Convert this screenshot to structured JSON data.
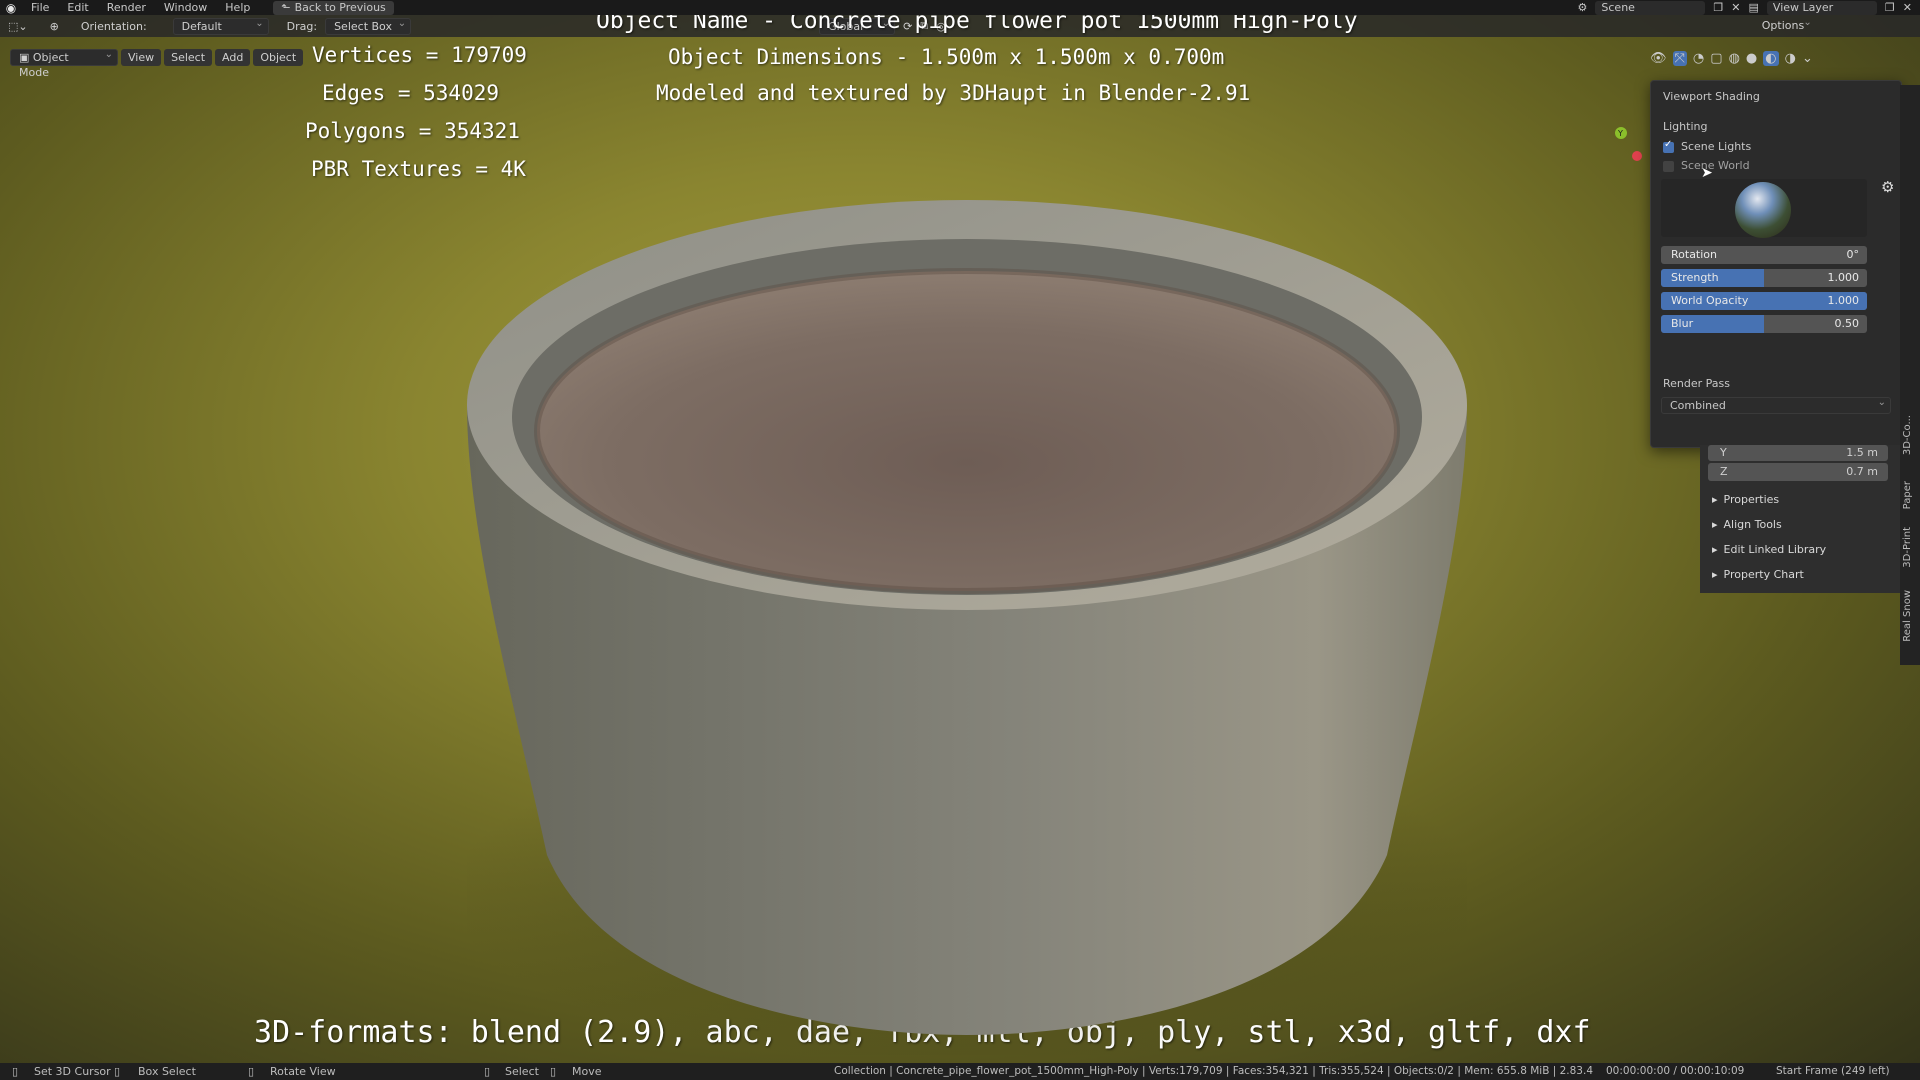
{
  "menu": {
    "items": [
      "File",
      "Edit",
      "Render",
      "Window",
      "Help"
    ],
    "back_label": "Back to Previous",
    "scene_label": "Scene",
    "view_layer_label": "View Layer"
  },
  "header": {
    "orientation_label": "Orientation:",
    "orientation_value": "Default",
    "drag_label": "Drag:",
    "drag_value": "Select Box",
    "transform_value": "Global",
    "options_label": "Options",
    "mode_value": "Object Mode",
    "view_label": "View",
    "select_label": "Select",
    "add_label": "Add",
    "object_label": "Object"
  },
  "overlay": {
    "vertices": "Vertices = 179709",
    "edges": "Edges = 534029",
    "polygons": "Polygons = 354321",
    "textures": "PBR Textures = 4K",
    "object_name": "Object Name - Concrete pipe flower pot 1500mm High-Poly",
    "dimensions": "Object Dimensions -  1.500m x 1.500m x 0.700m",
    "credit": "Modeled and textured by 3DHaupt in Blender-2.91",
    "formats": "3D-formats: blend (2.9), abc, dae, fbx, mtl, obj, ply, stl, x3d, gltf, dxf"
  },
  "shading": {
    "title": "Viewport Shading",
    "lighting_label": "Lighting",
    "scene_lights_label": "Scene Lights",
    "scene_lights_checked": true,
    "scene_world_label": "Scene World",
    "scene_world_checked": false,
    "rotation_label": "Rotation",
    "rotation_value": "0°",
    "strength_label": "Strength",
    "strength_value": "1.000",
    "strength_fill": 0.5,
    "opacity_label": "World Opacity",
    "opacity_value": "1.000",
    "opacity_fill": 1.0,
    "blur_label": "Blur",
    "blur_value": "0.50",
    "blur_fill": 0.5,
    "render_pass_label": "Render Pass",
    "render_pass_value": "Combined"
  },
  "npanel": {
    "y_label": "Y",
    "y_value": "1.5 m",
    "z_label": "Z",
    "z_value": "0.7 m",
    "items": [
      "Properties",
      "Align Tools",
      "Edit Linked Library",
      "Property Chart"
    ],
    "tabs": [
      "3D-Co...",
      "Paper",
      "3D-Print",
      "Real Snow"
    ]
  },
  "status": {
    "set_cursor": "Set 3D Cursor",
    "box_select": "Box Select",
    "rotate_view": "Rotate View",
    "select": "Select",
    "move": "Move",
    "info": "Collection | Concrete_pipe_flower_pot_1500mm_High-Poly | Verts:179,709 | Faces:354,321 | Tris:355,524 | Objects:0/2 | Mem: 655.8 MiB | 2.83.4",
    "time": "00:00:00:00 / 00:00:10:09",
    "frame": "Start Frame (249 left)"
  }
}
